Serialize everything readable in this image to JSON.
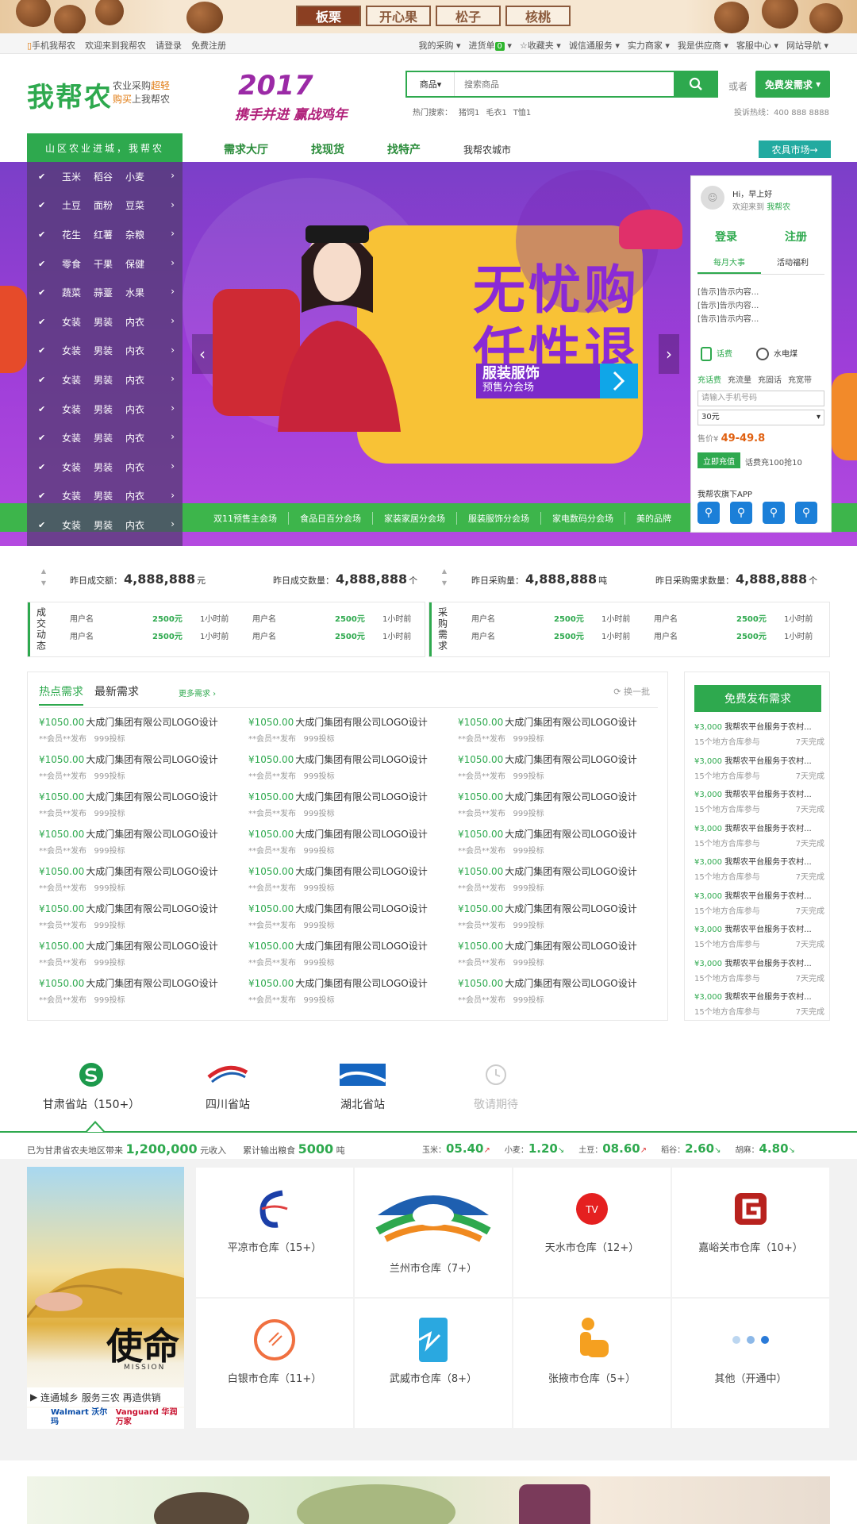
{
  "promo": {
    "tabs": [
      "板栗",
      "开心果",
      "松子",
      "核桃"
    ]
  },
  "topbar": {
    "left": [
      "手机我帮农",
      "欢迎来到我帮农",
      "请登录",
      "免费注册"
    ],
    "right": [
      "我的采购",
      "进货单",
      "收藏夹",
      "诚信通服务",
      "实力商家",
      "我是供应商",
      "客服中心",
      "网站导航"
    ],
    "cart_count": "0"
  },
  "header": {
    "logo": "我帮农",
    "slogan1": "农业采购",
    "slogan1b": "超轻",
    "slogan2": "购买",
    "slogan2b": "上我帮农",
    "year": "2017",
    "year_sub": "携手并进 赢战鸡年",
    "search_cat": "商品",
    "search_placeholder": "搜索商品",
    "or": "或者",
    "publish": "免费发需求",
    "hot_label": "热门搜索：",
    "hot": [
      "猪饲1",
      "毛衣1",
      "T恤1"
    ],
    "hotline": "投诉热线：400 888 8888"
  },
  "nav": {
    "cat_title": "山区农业进城，我帮农",
    "links": [
      "需求大厅",
      "找现货",
      "找特产"
    ],
    "plain_link": "我帮农城市",
    "tools": "农具市场→"
  },
  "catmenu": [
    [
      "玉米",
      "稻谷",
      "小麦"
    ],
    [
      "土豆",
      "面粉",
      "豆菜"
    ],
    [
      "花生",
      "红薯",
      "杂粮"
    ],
    [
      "零食",
      "干果",
      "保健"
    ],
    [
      "蔬菜",
      "蒜薹",
      "水果"
    ],
    [
      "女装",
      "男装",
      "内衣"
    ],
    [
      "女装",
      "男装",
      "内衣"
    ],
    [
      "女装",
      "男装",
      "内衣"
    ],
    [
      "女装",
      "男装",
      "内衣"
    ],
    [
      "女装",
      "男装",
      "内衣"
    ],
    [
      "女装",
      "男装",
      "内衣"
    ],
    [
      "女装",
      "男装",
      "内衣"
    ],
    [
      "女装",
      "男装",
      "内衣"
    ]
  ],
  "hero": {
    "title1": "无忧购",
    "title2": "任性退",
    "sub": "服装服饰",
    "sub2": "预售分会场",
    "strip": [
      "双11预售主会场",
      "食品日百分会场",
      "家装家居分会场",
      "服装服饰分会场",
      "家电数码分会场",
      "美的品牌"
    ]
  },
  "login": {
    "hi": "Hi，早上好",
    "welcome": "欢迎来到",
    "welcome_brand": "我帮农",
    "login": "登录",
    "register": "注册",
    "tabs": [
      "每月大事",
      "活动福利"
    ],
    "notices": [
      "[告示]告示内容...",
      "[告示]告示内容...",
      "[告示]告示内容..."
    ],
    "svc1": "话费",
    "svc2": "水电煤",
    "subtabs": [
      "充话费",
      "充流量",
      "充固话",
      "充宽带"
    ],
    "phone_placeholder": "请输入手机号码",
    "amount": "30元",
    "price_label": "售价¥",
    "price": "49-49.8",
    "recharge": "立即充值",
    "promo": "话费充100抢10",
    "app_title": "我帮农旗下APP"
  },
  "stats": [
    {
      "label": "昨日成交额：",
      "value": "4,888,888",
      "unit": "元"
    },
    {
      "label": "昨日成交数量：",
      "value": "4,888,888",
      "unit": "个"
    },
    {
      "label": "昨日采购量：",
      "value": "4,888,888",
      "unit": "吨"
    },
    {
      "label": "昨日采购需求数量：",
      "value": "4,888,888",
      "unit": "个"
    }
  ],
  "dyn": {
    "label1": "成交动态",
    "label2": "采购需求",
    "user": "用户名",
    "amount": "2500元",
    "time": "1小时前"
  },
  "demand": {
    "tabs": [
      "热点需求",
      "最新需求"
    ],
    "more": "更多需求 ›",
    "refresh": "换一批",
    "price": "¥1050.00",
    "title": "大成门集团有限公司LOGO设计",
    "sub": "**会员**发布",
    "bids": "999投标"
  },
  "free_demand": {
    "button": "免费发布需求",
    "price": "¥3,000",
    "text": "我帮农平台服务于农村...",
    "sub": "15个地方合库参与",
    "days": "7天完成"
  },
  "provinces": [
    {
      "name": "甘肃省站（150+）"
    },
    {
      "name": "四川省站"
    },
    {
      "name": "湖北省站"
    },
    {
      "name": "敬请期待"
    }
  ],
  "income": {
    "label": "已为甘肃省农夫地区带来",
    "value": "1,200,000",
    "unit": "元收入",
    "label2": "累计输出粮食",
    "value2": "5000",
    "unit2": "吨"
  },
  "prices": [
    {
      "name": "玉米：",
      "value": "05.40"
    },
    {
      "name": "小麦：",
      "value": "1.20"
    },
    {
      "name": "土豆：",
      "value": "08.60"
    },
    {
      "name": "稻谷：",
      "value": "2.60"
    },
    {
      "name": "胡麻：",
      "value": "4.80"
    }
  ],
  "mission": {
    "title": "使命",
    "en": "MISSION",
    "caption": "连通城乡  服务三农  再造供销",
    "brand1": "Walmart 沃尔玛",
    "brand2": "Vanguard 华润万家"
  },
  "warehouses": [
    "平凉市仓库（15+）",
    "兰州市仓库（7+）",
    "天水市仓库（12+）",
    "嘉峪关市仓库（10+）",
    "白银市仓库（11+）",
    "武威市仓库（8+）",
    "张掖市仓库（5+）",
    "其他（开通中）"
  ]
}
